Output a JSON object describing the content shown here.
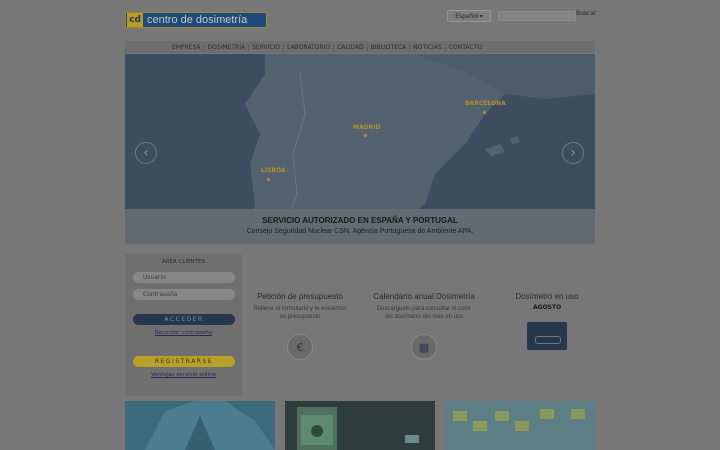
{
  "header": {
    "logo_mark": "cd",
    "logo_text": "centro de dosimetría",
    "language": "Español",
    "search_button": "Buscar"
  },
  "nav": {
    "items": [
      "EMPRESA",
      "DOSIMETRÍA",
      "SERVICIO",
      "LABORATORIO",
      "CALIDAD",
      "BIBLIOTECA",
      "NOTICIAS",
      "CONTACTO"
    ]
  },
  "hero": {
    "cities": {
      "barcelona": "BARCELONA",
      "madrid": "MADRID",
      "lisboa": "LISBOA"
    },
    "title": "SERVICIO AUTORIZADO EN ESPAÑA Y PORTUGAL",
    "subtitle": "Consejo Seguridad Nuclear CSN. Agência Portuguesa do Ambiente APA."
  },
  "clients": {
    "title": "ÁREA CLIENTES",
    "user_placeholder": "Usuario",
    "password_placeholder": "Contraseña",
    "login_button": "ACCEDER",
    "forgot_link": "Recordar contraseña",
    "register_button": "REGISTRARSE",
    "advantages_link": "Ventajas servicio online"
  },
  "features": {
    "quote": {
      "title": "Petición de presupuesto",
      "desc1": "Rellene el formulario y le enviamos",
      "desc2": "su presupuesto"
    },
    "calendar": {
      "title": "Calendario anual Dosimetría",
      "desc1": "Descárguelo para consultar el color",
      "desc2": "del dosímetro del mes en uso"
    },
    "dosimeter": {
      "title": "Dosímetro en uso",
      "month": "AGOSTO"
    }
  },
  "colors": {
    "accent": "#b09030",
    "brand_blue": "#1e4a7a",
    "login_button": "#26374d",
    "register_button": "#b8a12a"
  }
}
